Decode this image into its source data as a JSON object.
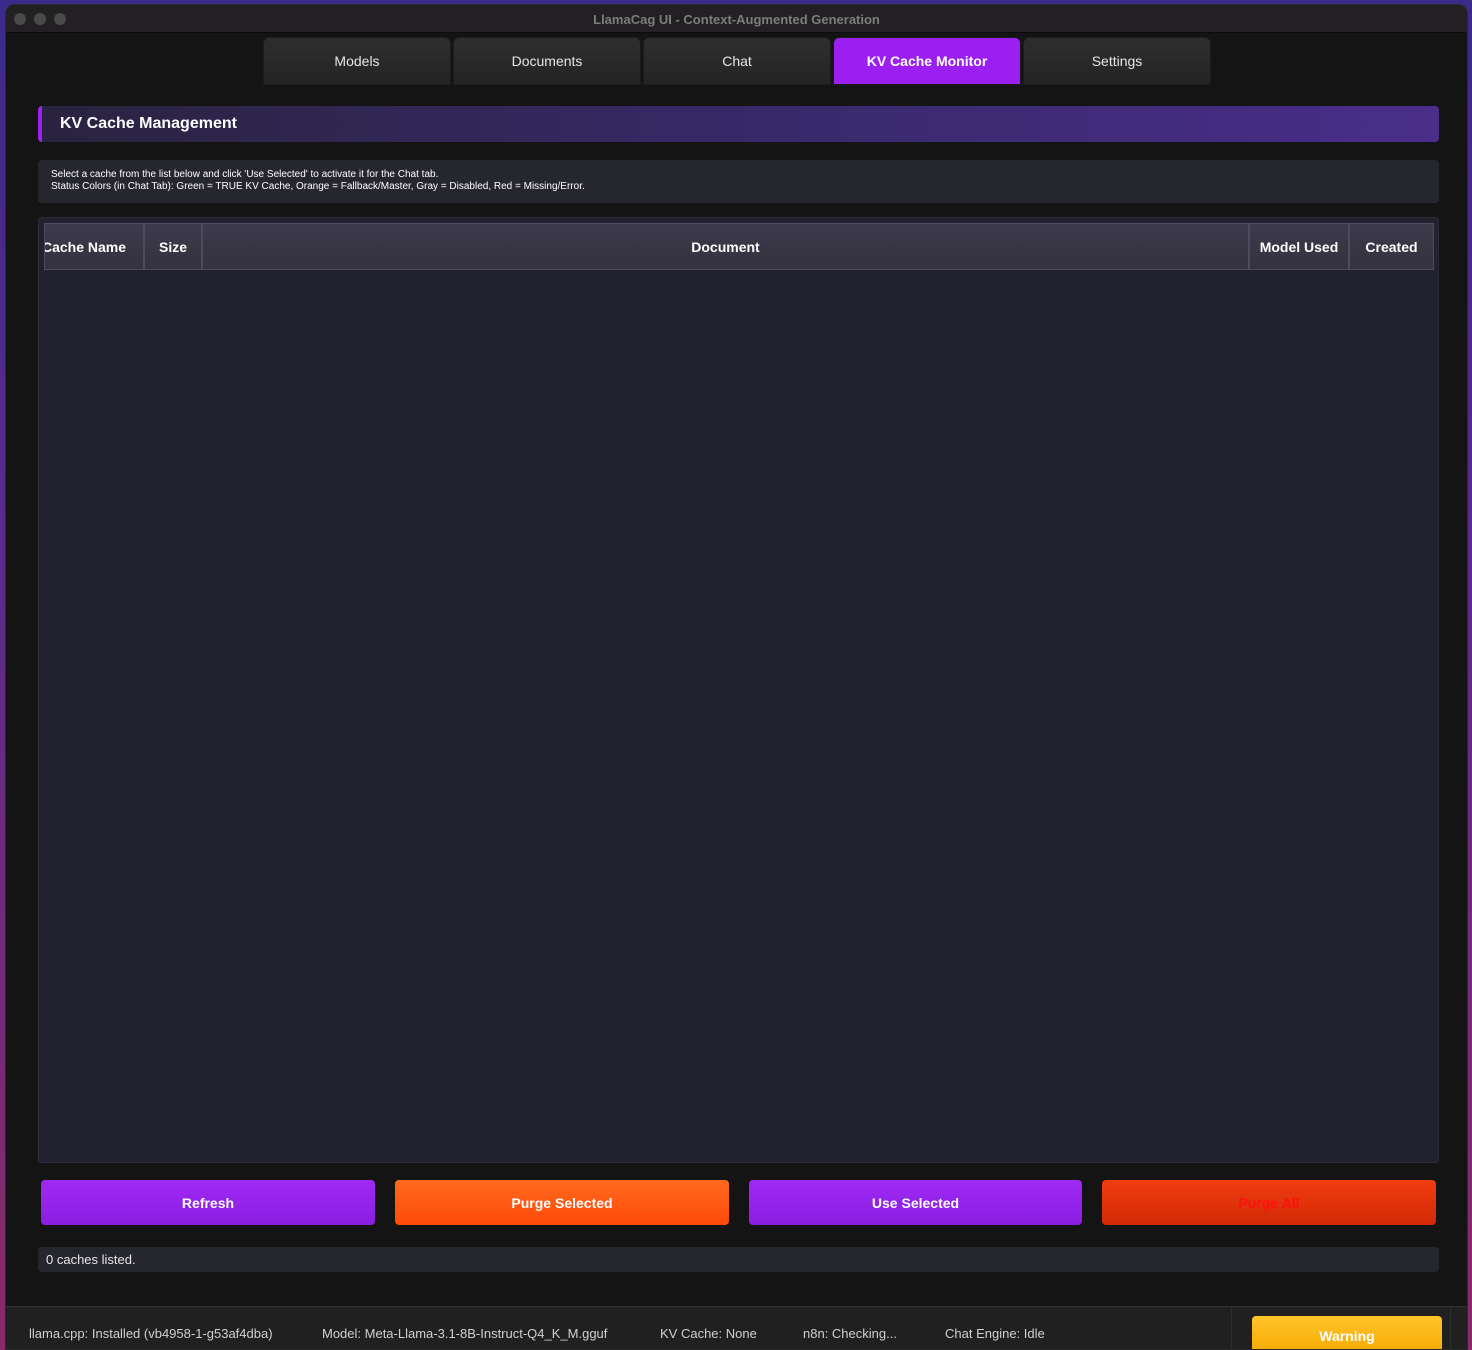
{
  "window": {
    "title": "LlamaCag UI - Context-Augmented Generation"
  },
  "tabs": [
    {
      "label": "Models",
      "active": false
    },
    {
      "label": "Documents",
      "active": false
    },
    {
      "label": "Chat",
      "active": false
    },
    {
      "label": "KV Cache Monitor",
      "active": true
    },
    {
      "label": "Settings",
      "active": false
    }
  ],
  "section": {
    "title": "KV Cache Management",
    "info_line1": "Select a cache from the list below and click 'Use Selected' to activate it for the Chat tab.",
    "info_line2": "Status Colors (in Chat Tab): Green = TRUE KV Cache, Orange = Fallback/Master, Gray = Disabled, Red = Missing/Error."
  },
  "table": {
    "columns": [
      "Cache Name",
      "Size",
      "Document",
      "Model Used",
      "Created"
    ],
    "rows": []
  },
  "buttons": {
    "refresh": "Refresh",
    "purge_selected": "Purge Selected",
    "use_selected": "Use Selected",
    "purge_all": "Purge All"
  },
  "status": {
    "caches_listed": "0 caches listed."
  },
  "footer": {
    "llama": "llama.cpp: Installed (vb4958-1-g53af4dba)",
    "model": "Model: Meta-Llama-3.1-8B-Instruct-Q4_K_M.gguf",
    "kv_cache": "KV Cache: None",
    "n8n": "n8n: Checking...",
    "chat_engine": "Chat Engine: Idle",
    "warning": "Warning"
  },
  "colors": {
    "accent_purple": "#9b1ff0",
    "purge_orange": "#ff5510",
    "purge_all_red": "#e0300a",
    "warning_yellow": "#ffbe1a"
  }
}
